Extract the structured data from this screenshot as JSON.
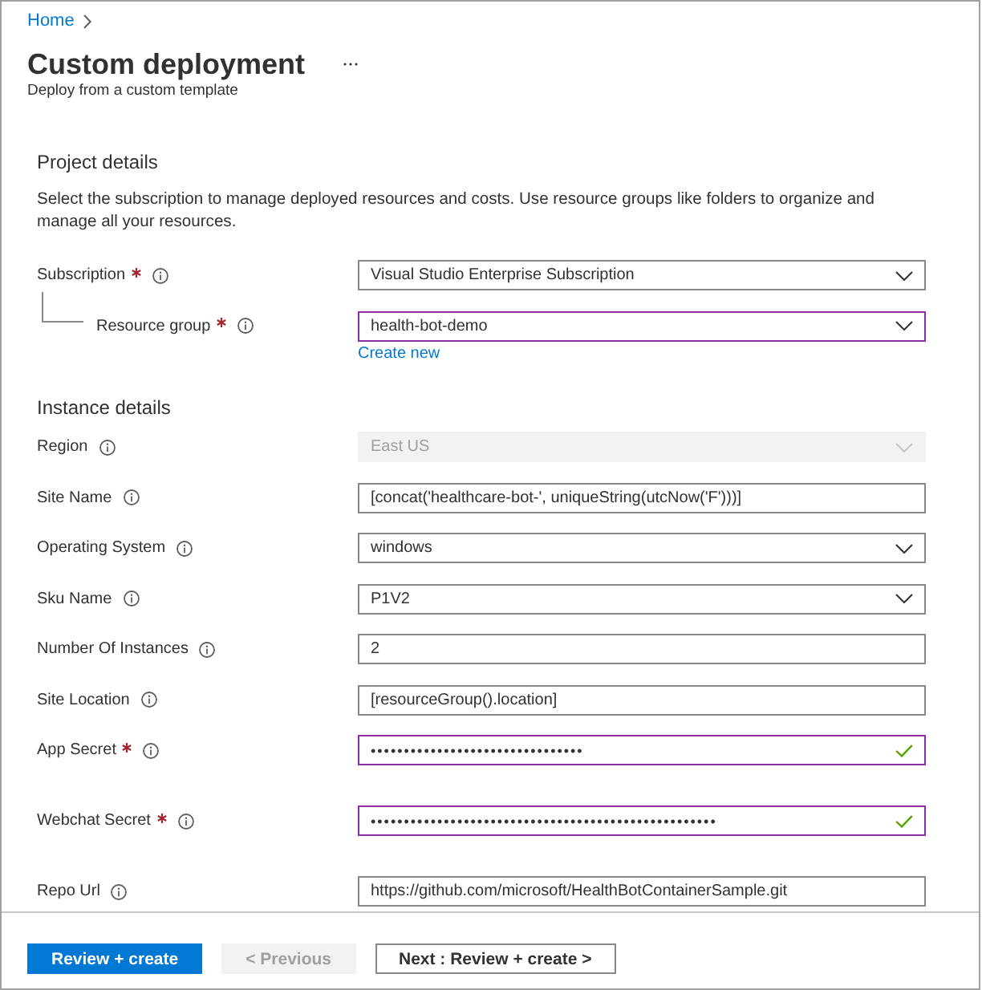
{
  "breadcrumb": [
    {
      "label": "Home"
    }
  ],
  "header": {
    "title": "Custom deployment",
    "subtitle": "Deploy from a custom template"
  },
  "sections": [
    {
      "title": "Project details",
      "description": "Select the subscription to manage deployed resources and costs. Use resource groups like folders to organize and manage all your resources.",
      "fields": [
        {
          "kind": "dropdown",
          "label": "Subscription",
          "required": true,
          "disabled": false,
          "highlighted": false,
          "valid": false,
          "value": "Visual Studio Enterprise Subscription",
          "children": [
            {
              "kind": "dropdown",
              "label": "Resource group",
              "required": true,
              "disabled": false,
              "highlighted": true,
              "valid": false,
              "value": "health-bot-demo",
              "link": "Create new"
            }
          ]
        }
      ]
    },
    {
      "title": "Instance details",
      "fields": [
        {
          "kind": "dropdown",
          "label": "Region",
          "required": false,
          "disabled": true,
          "highlighted": false,
          "valid": false,
          "value": "East US"
        },
        {
          "kind": "text",
          "label": "Site Name",
          "required": false,
          "disabled": false,
          "highlighted": false,
          "valid": false,
          "value": "[concat('healthcare-bot-', uniqueString(utcNow('F')))]"
        },
        {
          "kind": "dropdown",
          "label": "Operating System",
          "required": false,
          "disabled": false,
          "highlighted": false,
          "valid": false,
          "value": "windows"
        },
        {
          "kind": "dropdown",
          "label": "Sku Name",
          "required": false,
          "disabled": false,
          "highlighted": false,
          "valid": false,
          "value": "P1V2"
        },
        {
          "kind": "text",
          "label": "Number Of Instances",
          "required": false,
          "disabled": false,
          "highlighted": false,
          "valid": false,
          "value": "2"
        },
        {
          "kind": "text",
          "label": "Site Location",
          "required": false,
          "disabled": false,
          "highlighted": false,
          "valid": false,
          "value": "[resourceGroup().location]"
        },
        {
          "kind": "password",
          "label": "App Secret",
          "required": true,
          "disabled": false,
          "highlighted": true,
          "valid": true,
          "value": "••••••••••••••••••••••••••••••••"
        },
        {
          "kind": "password",
          "label": "Webchat Secret",
          "required": true,
          "disabled": false,
          "highlighted": true,
          "valid": true,
          "value": "••••••••••••••••••••••••••••••••••••••••••••••••••••"
        },
        {
          "kind": "text",
          "label": "Repo Url",
          "required": false,
          "disabled": false,
          "highlighted": false,
          "valid": false,
          "value": "https://github.com/microsoft/HealthBotContainerSample.git"
        }
      ]
    }
  ],
  "buttons": [
    {
      "label": "Review + create",
      "kind": "primary",
      "disabled": false
    },
    {
      "label": "< Previous",
      "kind": "secondary",
      "disabled": true
    },
    {
      "label": "Next : Review + create >",
      "kind": "secondary",
      "disabled": false
    }
  ]
}
